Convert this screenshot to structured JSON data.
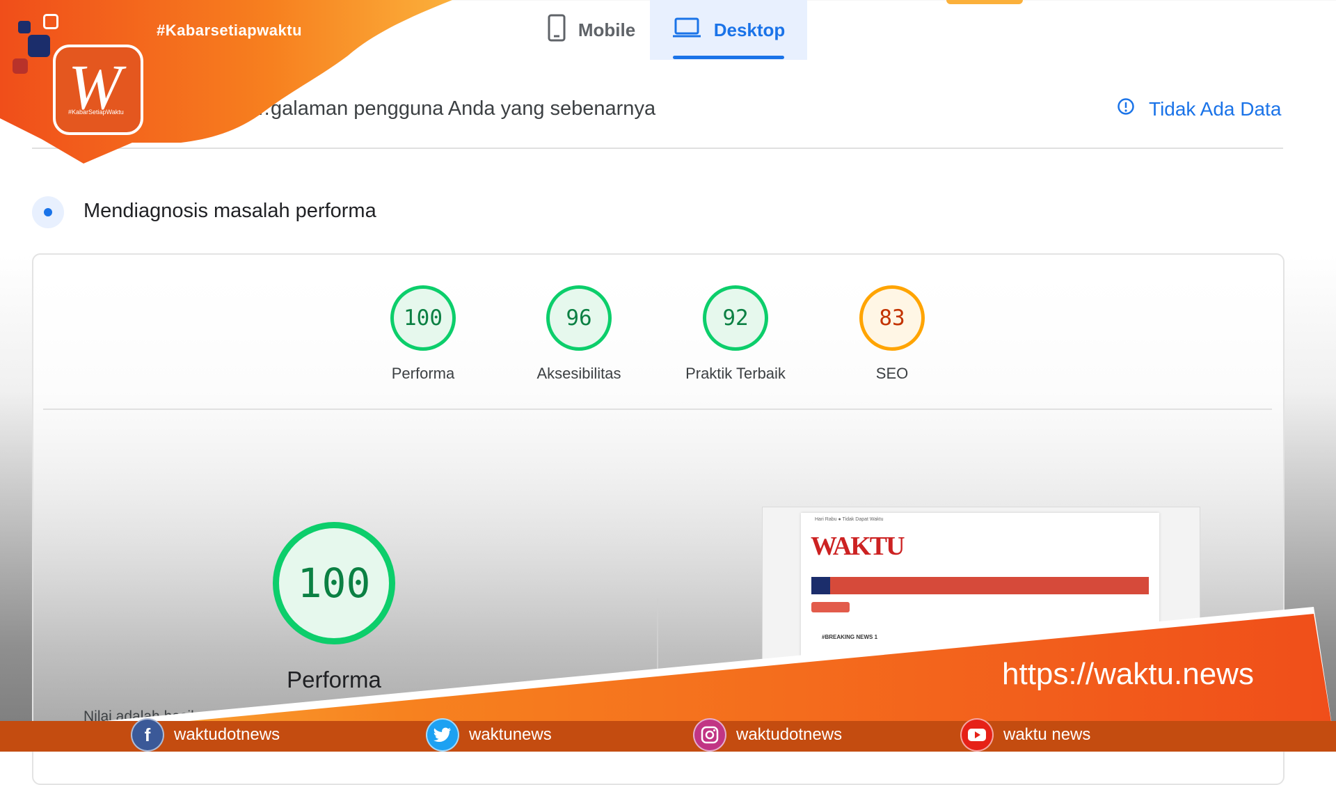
{
  "tabs": {
    "mobile": "Mobile",
    "desktop": "Desktop",
    "active": "Desktop"
  },
  "field_data": {
    "experience_text": "…galaman pengguna Anda yang sebenarnya",
    "no_data": "Tidak Ada Data"
  },
  "diagnose": {
    "title": "Mendiagnosis masalah performa"
  },
  "scores": [
    {
      "value": "100",
      "label": "Performa",
      "status": "good"
    },
    {
      "value": "96",
      "label": "Aksesibilitas",
      "status": "good"
    },
    {
      "value": "92",
      "label": "Praktik Terbaik",
      "status": "good"
    },
    {
      "value": "83",
      "label": "SEO",
      "status": "average"
    }
  ],
  "performance": {
    "value": "100",
    "label": "Performa",
    "note": "Nilai adalah hasil perkiraan"
  },
  "thumbnail": {
    "topbar": "Hari Rabu    ●  Tidak Dapat Waktu",
    "logo": "WAKTU",
    "breaking": "#BREAKING NEWS 1"
  },
  "branding": {
    "hashtag": "#Kabarsetiapwaktu",
    "logo_letter": "W",
    "logo_sub": "#KabarSetiapWaktu",
    "url": "https://waktu.news"
  },
  "social": [
    {
      "icon": "facebook-icon",
      "handle": "waktudotnews",
      "color": "#3b5998"
    },
    {
      "icon": "twitter-icon",
      "handle": "waktunews",
      "color": "#1da1f2"
    },
    {
      "icon": "instagram-icon",
      "handle": "waktudotnews",
      "color": "#c13584"
    },
    {
      "icon": "youtube-icon",
      "handle": "waktu news",
      "color": "#e62117"
    }
  ],
  "colors": {
    "accent": "#1a73e8",
    "good": "#0cce6b",
    "average": "#ffa400",
    "brand_orange": "#f15a1c"
  }
}
